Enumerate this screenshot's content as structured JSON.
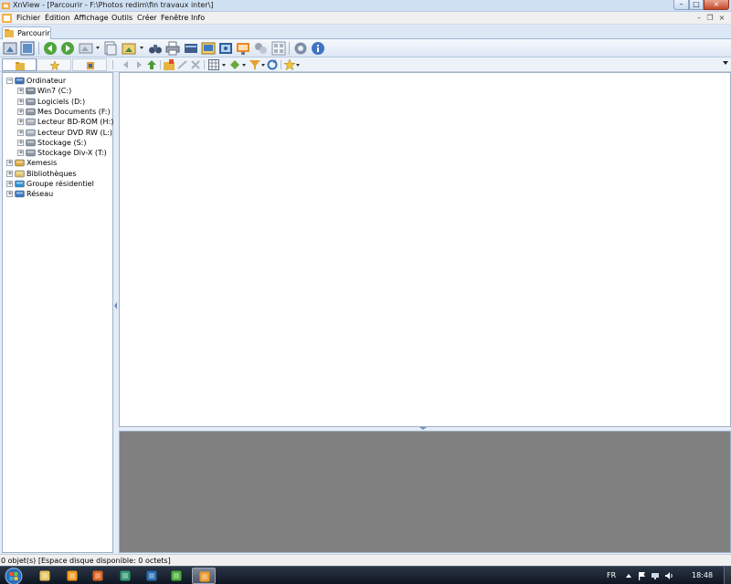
{
  "window": {
    "title": "XnView - [Parcourir - F:\\Photos redim\\fin travaux inter\\]",
    "controls": {
      "minimize": "–",
      "maximize": "□",
      "close": "×"
    },
    "mdi_controls": {
      "minimize": "–",
      "restore": "❐",
      "close": "×"
    }
  },
  "menubar": {
    "items": [
      "Fichier",
      "Édition",
      "Affichage",
      "Outils",
      "Créer",
      "Fenêtre",
      "Info"
    ]
  },
  "tabs": [
    {
      "label": "Parcourir",
      "icon": "browse-folder-icon"
    }
  ],
  "toolbar": {
    "buttons": [
      {
        "name": "acquire-icon"
      },
      {
        "name": "fullscreen-icon"
      },
      {
        "name": "back-icon"
      },
      {
        "name": "forward-icon"
      },
      {
        "name": "open-image-icon"
      },
      {
        "name": "browse-icon"
      },
      {
        "name": "filter-icon"
      },
      {
        "name": "binoculars-icon"
      },
      {
        "name": "print-icon"
      },
      {
        "name": "scanner-icon"
      },
      {
        "name": "slideshow-icon"
      },
      {
        "name": "capture-icon"
      },
      {
        "name": "web-page-icon"
      },
      {
        "name": "batch-icon"
      },
      {
        "name": "contact-sheet-icon"
      },
      {
        "name": "settings-icon"
      },
      {
        "name": "info-icon"
      }
    ]
  },
  "subbar": {
    "side_tabs": [
      {
        "name": "folders-tab",
        "icon": "folders-icon",
        "active": true
      },
      {
        "name": "favorites-tab",
        "icon": "star-icon",
        "active": false
      },
      {
        "name": "categories-tab",
        "icon": "categories-icon",
        "active": false
      }
    ],
    "buttons": [
      {
        "name": "nav-back-icon"
      },
      {
        "name": "nav-forward-icon"
      },
      {
        "name": "parent-folder-icon"
      },
      {
        "name": "new-folder-icon"
      },
      {
        "name": "move-icon"
      },
      {
        "name": "delete-icon"
      },
      {
        "name": "view-mode-icon"
      },
      {
        "name": "sort-icon"
      },
      {
        "name": "filter-funnel-icon"
      },
      {
        "name": "refresh-icon"
      },
      {
        "name": "rating-icon"
      }
    ]
  },
  "tree": {
    "nodes": [
      {
        "label": "Ordinateur",
        "level": 0,
        "expander": "−",
        "icon": "computer-icon",
        "color": "#3a6fb8"
      },
      {
        "label": "Win7 (C:)",
        "level": 1,
        "expander": "+",
        "icon": "system-drive-icon",
        "color": "#7b8796"
      },
      {
        "label": "Logiciels (D:)",
        "level": 1,
        "expander": "+",
        "icon": "hard-drive-icon",
        "color": "#8c96a3"
      },
      {
        "label": "Mes Documents (F:)",
        "level": 1,
        "expander": "+",
        "icon": "hard-drive-icon",
        "color": "#8c96a3"
      },
      {
        "label": "Lecteur BD-ROM (H:)",
        "level": 1,
        "expander": "+",
        "icon": "optical-drive-icon",
        "color": "#a8b0ba"
      },
      {
        "label": "Lecteur DVD RW (L:)",
        "level": 1,
        "expander": "+",
        "icon": "optical-drive-icon",
        "color": "#a8b0ba"
      },
      {
        "label": "Stockage (S:)",
        "level": 1,
        "expander": "+",
        "icon": "hard-drive-icon",
        "color": "#8c96a3"
      },
      {
        "label": "Stockage Div-X (T:)",
        "level": 1,
        "expander": "+",
        "icon": "hard-drive-icon",
        "color": "#8c96a3"
      },
      {
        "label": "Xemesis",
        "level": 0,
        "expander": "+",
        "icon": "user-folder-icon",
        "color": "#d9a93a"
      },
      {
        "label": "Bibliothèques",
        "level": 0,
        "expander": "+",
        "icon": "libraries-icon",
        "color": "#e0c064"
      },
      {
        "label": "Groupe résidentiel",
        "level": 0,
        "expander": "+",
        "icon": "homegroup-icon",
        "color": "#2f8fd1"
      },
      {
        "label": "Réseau",
        "level": 0,
        "expander": "+",
        "icon": "network-icon",
        "color": "#3a78c0"
      }
    ]
  },
  "statusbar": {
    "text": "0 objet(s) [Espace disque disponible: 0 octets]"
  },
  "taskbar": {
    "apps": [
      {
        "name": "explorer-icon",
        "color": "#e7c25b",
        "active": false
      },
      {
        "name": "media-player-icon",
        "color": "#f29a1f",
        "active": false
      },
      {
        "name": "firefox-icon",
        "color": "#e0621f",
        "active": false
      },
      {
        "name": "search-tool-icon",
        "color": "#2f9a72",
        "active": false
      },
      {
        "name": "photoshop-icon",
        "color": "#2b6db3",
        "active": false
      },
      {
        "name": "network-app-icon",
        "color": "#4cae3c",
        "active": false
      },
      {
        "name": "xnview-icon",
        "color": "#f09a2a",
        "active": true
      }
    ],
    "language": "FR",
    "clock": "18:48"
  },
  "colors": {
    "accent": "#3a6fb8",
    "preview_background": "#808080",
    "window_background": "#e4ecf7"
  }
}
